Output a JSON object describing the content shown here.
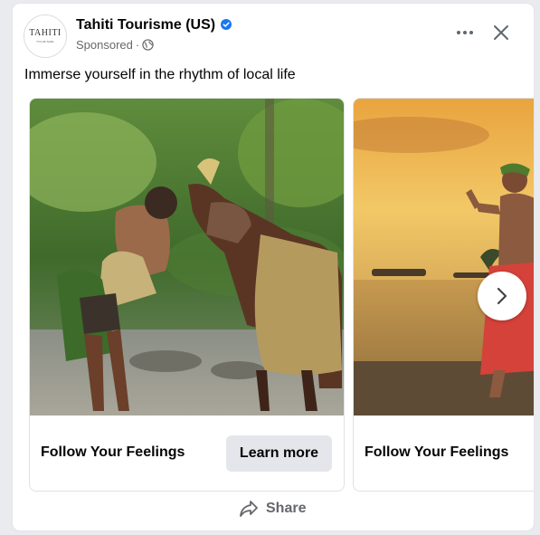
{
  "post": {
    "avatar_logo": "TAHITI",
    "avatar_logo_sub": "TOURISME",
    "page_name": "Tahiti Tourisme (US)",
    "meta_label": "Sponsored",
    "meta_separator": "·",
    "caption": "Immerse yourself in the rhythm of local life"
  },
  "icons": {
    "verified": "verified-badge-icon",
    "privacy": "globe-icon",
    "more": "more-options-icon",
    "close": "close-icon",
    "next": "chevron-right-icon",
    "share": "share-arrow-icon"
  },
  "carousel": {
    "cards": [
      {
        "title": "Follow Your Feelings",
        "cta_label": "Learn more",
        "image": "man-with-horse-photo"
      },
      {
        "title": "Follow Your Feelings",
        "image": "dancer-at-sunset-photo"
      }
    ]
  },
  "actions": {
    "share_label": "Share"
  },
  "colors": {
    "verified_blue": "#1877f2",
    "secondary_text": "#65676b",
    "button_gray": "#e4e6eb"
  }
}
